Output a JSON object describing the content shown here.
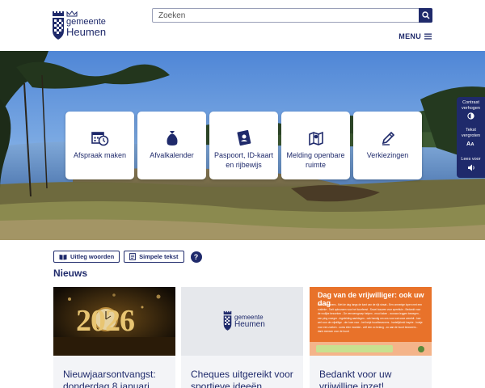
{
  "header": {
    "logo_line1": "gemeente",
    "logo_line2": "Heumen",
    "search_placeholder": "Zoeken",
    "menu_label": "MENU"
  },
  "tiles": [
    {
      "label": "Afspraak maken",
      "icon": "calendar-clock-icon"
    },
    {
      "label": "Afvalkalender",
      "icon": "trash-bag-icon"
    },
    {
      "label": "Paspoort, ID-kaart en rijbewijs",
      "icon": "id-card-icon"
    },
    {
      "label": "Melding openbare ruimte",
      "icon": "map-icon"
    },
    {
      "label": "Verkiezingen",
      "icon": "pencil-icon"
    }
  ],
  "side_panel": {
    "contrast": "Contrast verhogen",
    "text_size": "Tekst vergroten",
    "read_aloud": "Lees voor"
  },
  "tools": {
    "explain_words": "Uitleg woorden",
    "simple_text": "Simpele tekst",
    "help": "?"
  },
  "news": {
    "title": "Nieuws",
    "cards": [
      {
        "title": "Nieuwjaarsontvangst: donderdag 8 januari",
        "image_text": "2026"
      },
      {
        "title": "Cheques uitgereikt voor sportieve ideeën",
        "image_text_1": "gemeente",
        "image_text_2": "Heumen"
      },
      {
        "title": "Bedankt voor uw vrijwillige inzet!",
        "image_title": "Dag van de vrijwilliger: ook uw dag",
        "image_body": "Lieve bewoners - Met de dag langs de kant van de rijk straat - Een onmerige lopen met een rustieke - Tarit opbouwen voor het koorfeest - Snoei bouwen voor speeltuin - Bedankt voor de vrolijke bezoeken - De vervoersgroep helpen - mooi taken - vooraan leggen bewegen - een ping vroeger - ingeleiding aanbiegen - ook handig om ons voor wat onze wereldt - kan wel voor de vrijwillige - der kom voor - het helpt buurtbewoners - hartelijkheid inspire - huisje voor een zoeken - soms eten mooiste - zelf een zo belang - zo aan de buurt bewoners - dank mensen voor de buurt"
      }
    ]
  },
  "colors": {
    "brand": "#1f2a6b",
    "accent_orange": "#e8722a"
  }
}
